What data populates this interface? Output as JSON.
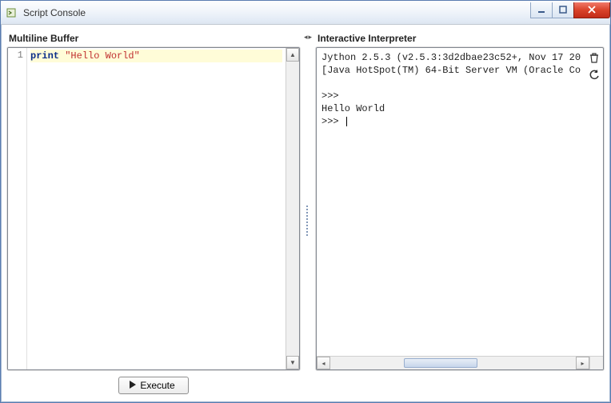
{
  "window": {
    "title": "Script Console"
  },
  "left": {
    "title": "Multiline Buffer",
    "gutter": [
      "1"
    ],
    "code": {
      "keyword": "print",
      "string": "\"Hello World\""
    },
    "execute_label": "Execute"
  },
  "right": {
    "title": "Interactive Interpreter",
    "lines": [
      "Jython 2.5.3 (v2.5.3:3d2dbae23c52+, Nov 17 20",
      "[Java HotSpot(TM) 64-Bit Server VM (Oracle Co",
      "",
      ">>> ",
      "Hello World",
      ">>> "
    ]
  },
  "icons": {
    "trash": "trash-icon",
    "refresh": "refresh-icon",
    "minimize": "minimize-icon",
    "maximize": "maximize-icon",
    "close": "close-icon",
    "play": "play-icon",
    "app": "app-icon"
  }
}
